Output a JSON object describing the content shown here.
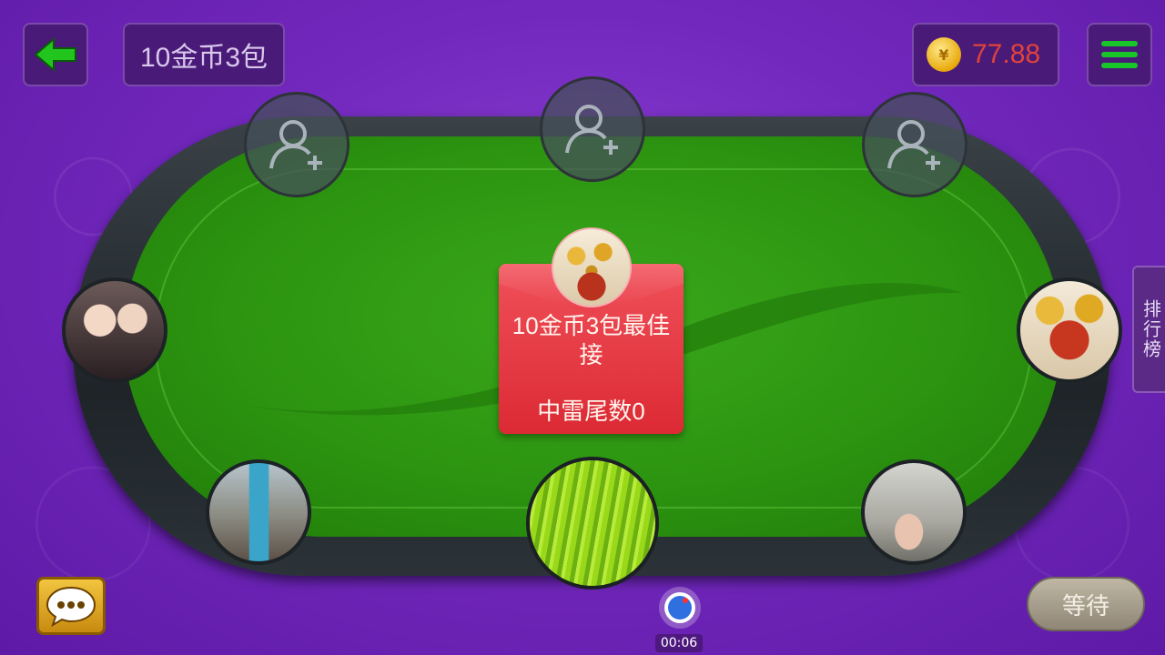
{
  "header": {
    "back_icon": "arrow-left-icon",
    "room_label": "10金币3包",
    "coin_icon": "gold-coin-icon",
    "coin_symbol": "¥",
    "coin_balance": "77.88",
    "menu_icon": "hamburger-menu-icon"
  },
  "seats": {
    "empty_icon": "add-user-icon",
    "empty_count": 3
  },
  "packet": {
    "title": "10金币3包最佳接",
    "subtitle": "中雷尾数0",
    "color": "#e8333d"
  },
  "side": {
    "leaderboard_label": "排行榜"
  },
  "footer": {
    "chat_icon": "chat-bubble-icon",
    "wait_label": "等待",
    "record_icon": "record-icon",
    "timer": "00:06"
  },
  "colors": {
    "background": "#7228bd",
    "felt": "#2c9410",
    "balance_text": "#e0433a",
    "menu_bars": "#19c62a"
  }
}
